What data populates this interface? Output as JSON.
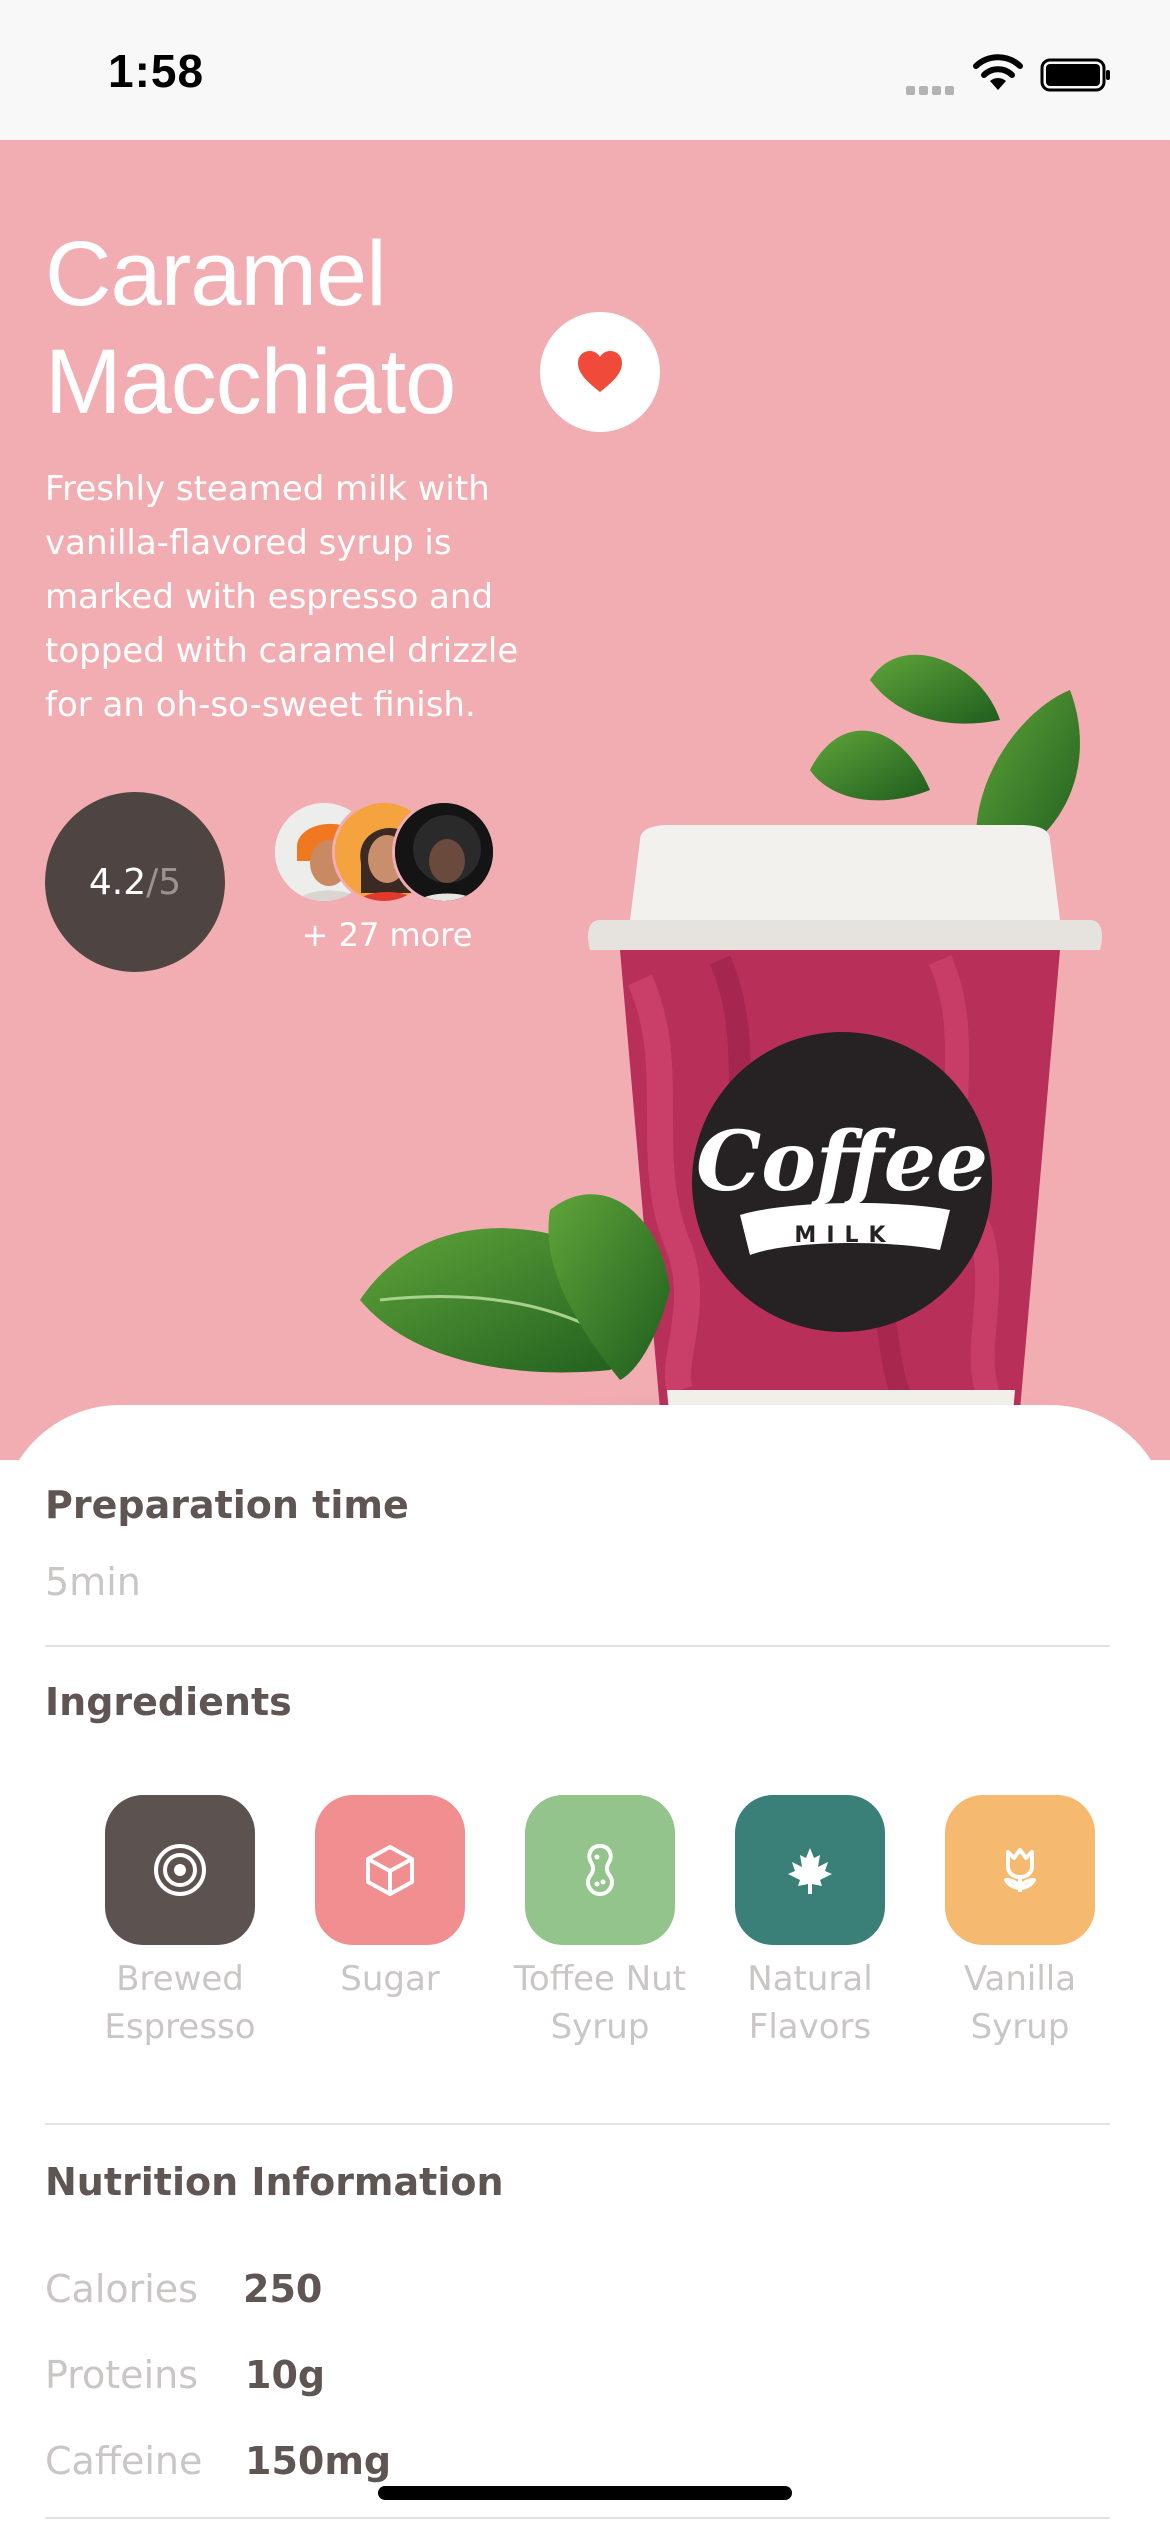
{
  "status_bar": {
    "time": "1:58"
  },
  "product": {
    "title_line1": "Caramel",
    "title_line2": "Macchiato",
    "description": "Freshly steamed milk with vanilla-flavored syrup is marked with espresso and topped with caramel drizzle for an oh-so-sweet finish.",
    "rating": "4.2",
    "rating_total": "/5",
    "more_reviewers": "+ 27 more",
    "cup_logo_text": "Coffee",
    "cup_logo_sub": "MILK"
  },
  "preparation": {
    "title": "Preparation time",
    "value": "5min"
  },
  "ingredients": {
    "title": "Ingredients",
    "items": [
      {
        "label_line1": "Brewed",
        "label_line2": "Espresso",
        "color": "#5c5351",
        "icon": "target-icon"
      },
      {
        "label_line1": "Sugar",
        "label_line2": "",
        "color": "#f08e90",
        "icon": "cube-icon"
      },
      {
        "label_line1": "Toffee Nut",
        "label_line2": "Syrup",
        "color": "#92c48b",
        "icon": "peanut-icon"
      },
      {
        "label_line1": "Natural",
        "label_line2": "Flavors",
        "color": "#3a8078",
        "icon": "maple-leaf-icon"
      },
      {
        "label_line1": "Vanilla",
        "label_line2": "Syrup",
        "color": "#f5b96f",
        "icon": "flower-icon"
      }
    ]
  },
  "nutrition": {
    "title": "Nutrition Information",
    "rows": [
      {
        "label": "Calories",
        "value": "250"
      },
      {
        "label": "Proteins",
        "value": "10g"
      },
      {
        "label": "Caffeine",
        "value": "150mg"
      }
    ]
  },
  "colors": {
    "hero_bg": "#f2adb3",
    "dark": "#4e4442",
    "heart": "#f04a3a"
  }
}
